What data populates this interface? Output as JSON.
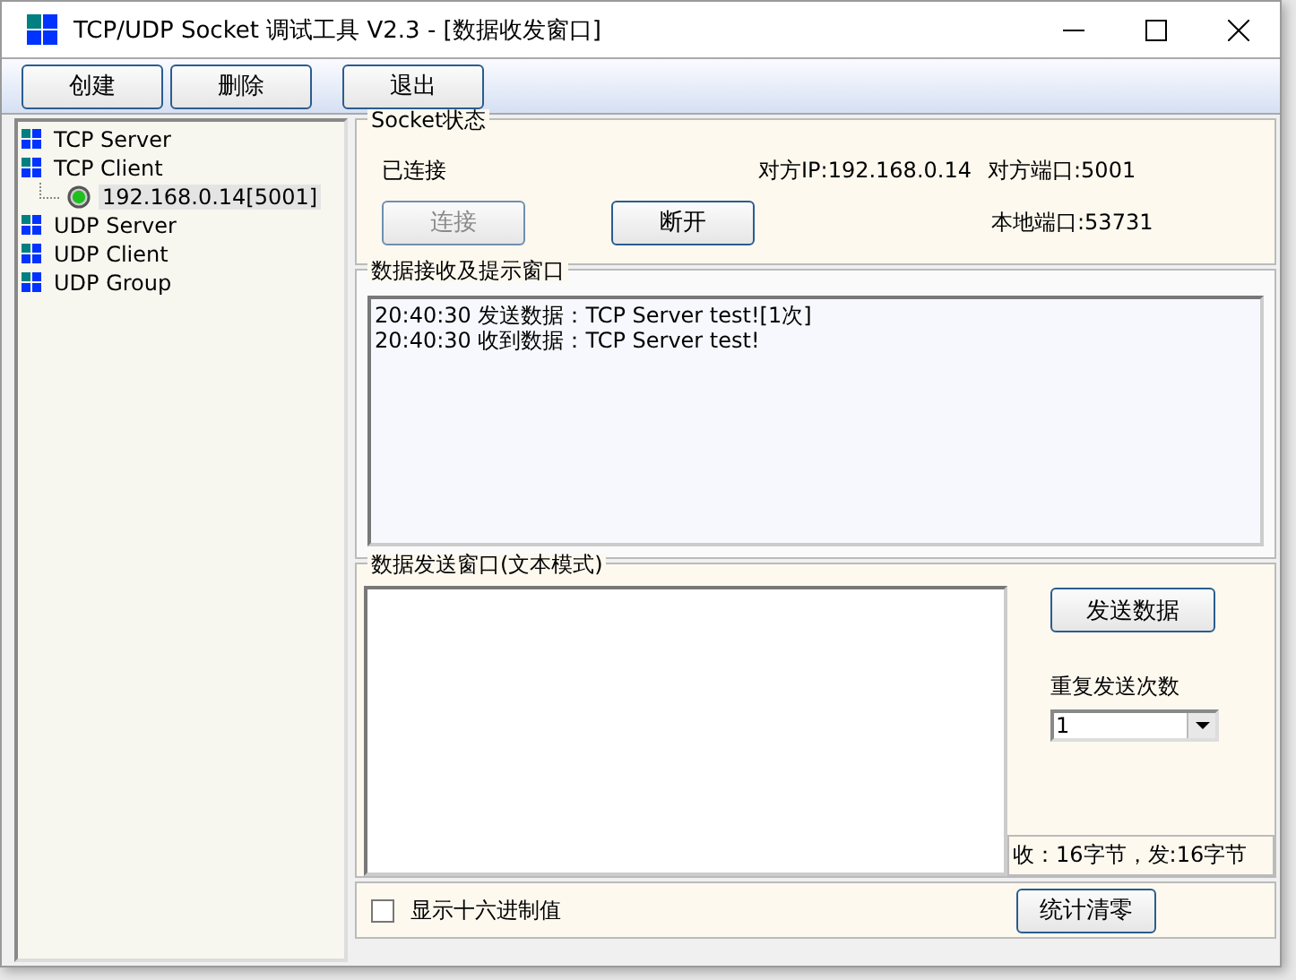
{
  "window": {
    "title": "TCP/UDP Socket 调试工具 V2.3 - [数据收发窗口]"
  },
  "toolbar": [
    {
      "label": "创建"
    },
    {
      "label": "删除"
    },
    {
      "label": "退出"
    }
  ],
  "tree": [
    {
      "label": "TCP Server",
      "kind": "group",
      "selected": false
    },
    {
      "label": "TCP Client",
      "kind": "group",
      "selected": false,
      "children": [
        {
          "label": "192.168.0.14[5001]",
          "kind": "connection",
          "selected": true
        }
      ]
    },
    {
      "label": "UDP Server",
      "kind": "group",
      "selected": false
    },
    {
      "label": "UDP Client",
      "kind": "group",
      "selected": false
    },
    {
      "label": "UDP Group",
      "kind": "group",
      "selected": false
    }
  ],
  "socket_status": {
    "title": "Socket状态",
    "state": "已连接",
    "remote_ip": "对方IP:192.168.0.14",
    "remote_port": "对方端口:5001",
    "local_port": "本地端口:53731",
    "buttons": [
      {
        "label": "连接",
        "disabled": true
      },
      {
        "label": "断开",
        "disabled": false
      }
    ]
  },
  "receive": {
    "title": "数据接收及提示窗口",
    "lines": [
      "20:40:30 发送数据：TCP Server test![1次]",
      "20:40:30 收到数据：TCP Server test!"
    ]
  },
  "send": {
    "title": "数据发送窗口(文本模式)",
    "send_button": "发送数据",
    "repeat_label": "重复发送次数",
    "repeat_value": "1",
    "stats": "收：16字节，发:16字节"
  },
  "bottom": {
    "hex_checkbox": {
      "label": "显示十六进制值",
      "checked": false
    },
    "clear_button": "统计清零"
  }
}
